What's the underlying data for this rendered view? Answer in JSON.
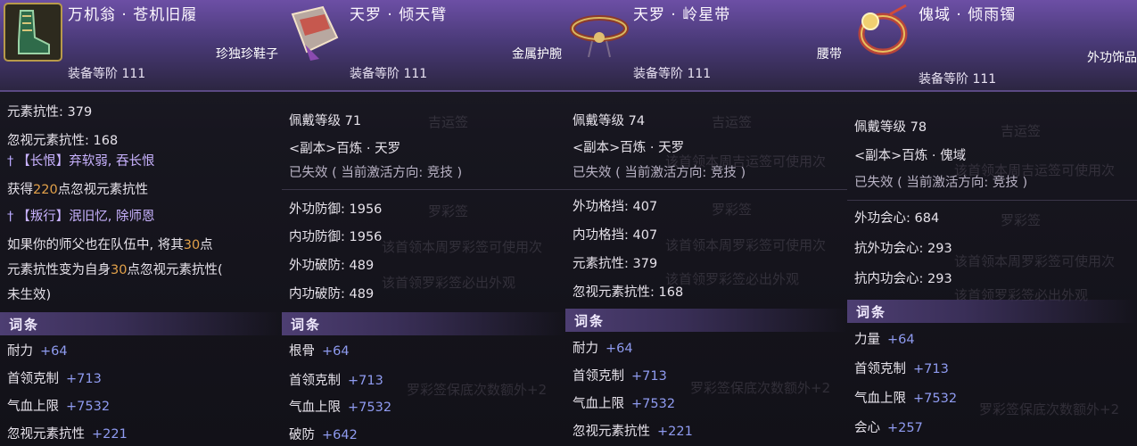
{
  "panels": [
    {
      "name": "万机翁 · 苍机旧履",
      "slot": "珍独珍鞋子",
      "gear_score": "装备等阶 111",
      "lines": [
        {
          "text": "元素抗性: 379"
        },
        {
          "text": "忽视元素抗性: 168"
        }
      ],
      "skill1": "【长恨】弃软弱, 吞长恨",
      "gain": {
        "pre": "获得",
        "num": "220",
        "post": "点忽视元素抗性"
      },
      "skill2": "【叛行】泯旧忆, 除师恩",
      "desc1": {
        "pre": "如果你的师父也在队伍中, 将其",
        "num": "30",
        "post": "点"
      },
      "desc2": {
        "pre": "元素抗性变为自身",
        "num": "30",
        "post": "点忽视元素抗性("
      },
      "desc3": "未生效)",
      "section": "词条",
      "attrs": [
        {
          "label": "耐力",
          "value": "+64"
        },
        {
          "label": "首领克制",
          "value": "+713"
        },
        {
          "label": "气血上限",
          "value": "+7532"
        },
        {
          "label": "忽视元素抗性",
          "value": "+221"
        }
      ]
    },
    {
      "name": "天罗 · 倾天臂",
      "slot": "金属护腕",
      "gear_score": "装备等阶 111",
      "level": "佩戴等级 71",
      "source": "<副本>百炼 · 天罗",
      "invalid": "已失效 ( 当前激活方向: 竞技 )",
      "stats": [
        {
          "text": "外功防御: 1956"
        },
        {
          "text": "内功防御: 1956"
        },
        {
          "text": "外功破防: 489"
        },
        {
          "text": "内功破防: 489"
        }
      ],
      "section": "词条",
      "attrs": [
        {
          "label": "根骨",
          "value": "+64"
        },
        {
          "label": "首领克制",
          "value": "+713"
        },
        {
          "label": "气血上限",
          "value": "+7532"
        },
        {
          "label": "破防",
          "value": "+642"
        }
      ]
    },
    {
      "name": "天罗 · 岭星带",
      "slot": "腰带",
      "gear_score": "装备等阶 111",
      "level": "佩戴等级 74",
      "source": "<副本>百炼 · 天罗",
      "invalid": "已失效 ( 当前激活方向: 竞技 )",
      "stats": [
        {
          "text": "外功格挡: 407"
        },
        {
          "text": "内功格挡: 407"
        },
        {
          "text": "元素抗性: 379"
        },
        {
          "text": "忽视元素抗性: 168"
        }
      ],
      "section": "词条",
      "attrs": [
        {
          "label": "耐力",
          "value": "+64"
        },
        {
          "label": "首领克制",
          "value": "+713"
        },
        {
          "label": "气血上限",
          "value": "+7532"
        },
        {
          "label": "忽视元素抗性",
          "value": "+221"
        }
      ]
    },
    {
      "name": "傀域 · 倾雨镯",
      "slot": "外功饰品",
      "gear_score": "装备等阶 111",
      "level": "佩戴等级 78",
      "source": "<副本>百炼 · 傀域",
      "invalid": "已失效 ( 当前激活方向: 竞技 )",
      "stats": [
        {
          "text": "外功会心: 684"
        },
        {
          "text": "抗外功会心: 293"
        },
        {
          "text": "抗内功会心: 293"
        }
      ],
      "section": "词条",
      "attrs": [
        {
          "label": "力量",
          "value": "+64"
        },
        {
          "label": "首领克制",
          "value": "+713"
        },
        {
          "label": "气血上限",
          "value": "+7532"
        },
        {
          "label": "会心",
          "value": "+257"
        }
      ]
    }
  ],
  "background_text": {
    "lucky": "吉运签",
    "luocai": "罗彩签",
    "weekly_lucky": "该首领本周吉运签可使用次",
    "weekly_luocai": "该首领本周罗彩签可使用次",
    "drop_luocai": "该首领罗彩签必出外观",
    "guarantee": "罗彩签保底次数额外+2"
  },
  "colors": {
    "header": "#5a44906",
    "highlight": "#e2a14a",
    "plus": "#8f9bf0",
    "skill": "#c9b3ff"
  }
}
